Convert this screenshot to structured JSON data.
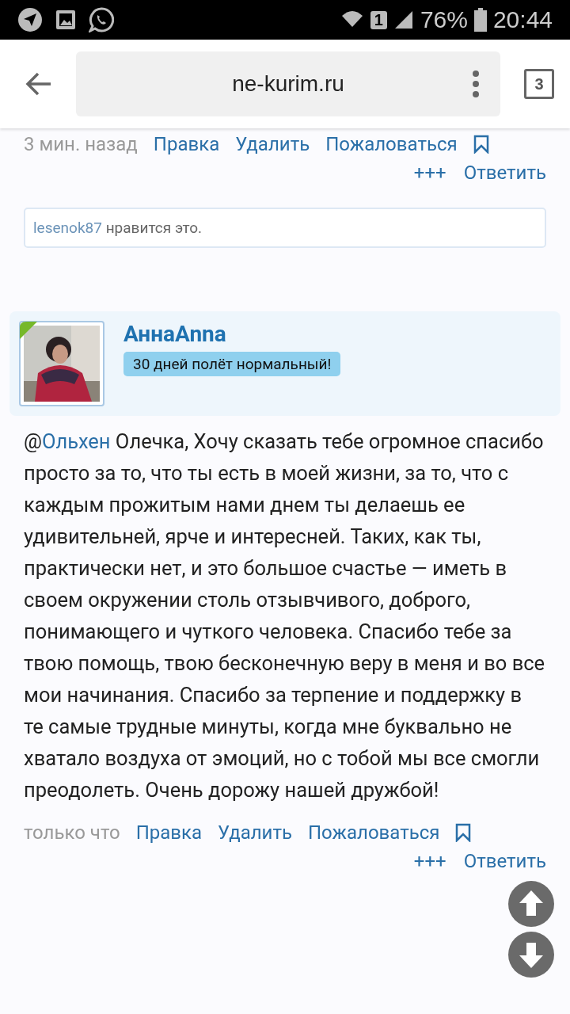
{
  "status_bar": {
    "sim": "1",
    "battery": "76%",
    "time": "20:44"
  },
  "browser": {
    "url": "ne-kurim.ru",
    "tab_count": "3"
  },
  "prev_post": {
    "time": "3 мин. назад",
    "actions": [
      "Правка",
      "Удалить",
      "Пожаловаться"
    ],
    "actions2": [
      "+++",
      "Ответить"
    ],
    "likes": {
      "user": "lesenok87",
      "text": "нравится это."
    }
  },
  "post": {
    "author": "АннаAnna",
    "status": "30 дней полёт нормальный!",
    "mention": {
      "at": "@",
      "name": "Ольхен"
    },
    "text": "Олечка, Хочу сказать тебе огромное спасибо просто за то, что ты есть в моей жизни, за то, что с каждым прожитым нами днем ты делаешь ее удивительней, ярче и интересней. Таких, как ты, практически нет, и это большое счастье — иметь в своем окружении столь отзывчивого, доброго, понимающего и чуткого человека. Спасибо тебе за твою помощь, твою бесконечную веру в меня и во все мои начинания. Спасибо за терпение и поддержку в те самые трудные минуты, когда мне буквально не хватало воздуха от эмоций, но с тобой мы все смогли преодолеть. Очень дорожу нашей дружбой!",
    "time": "только что",
    "actions": [
      "Правка",
      "Удалить",
      "Пожаловаться"
    ],
    "actions2": [
      "+++",
      "Ответить"
    ]
  }
}
